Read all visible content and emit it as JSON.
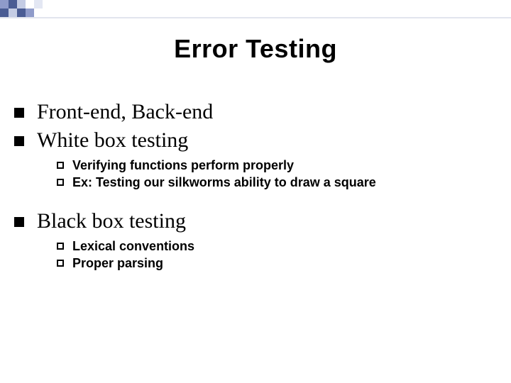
{
  "title": "Error Testing",
  "bullets": {
    "b1": "Front-end, Back-end",
    "b2": "White box testing",
    "b2_subs": {
      "s1": "Verifying functions perform properly",
      "s2": "Ex: Testing our silkworms ability to draw a square"
    },
    "b3": "Black box testing",
    "b3_subs": {
      "s1": "Lexical conventions",
      "s2": "Proper parsing"
    }
  }
}
